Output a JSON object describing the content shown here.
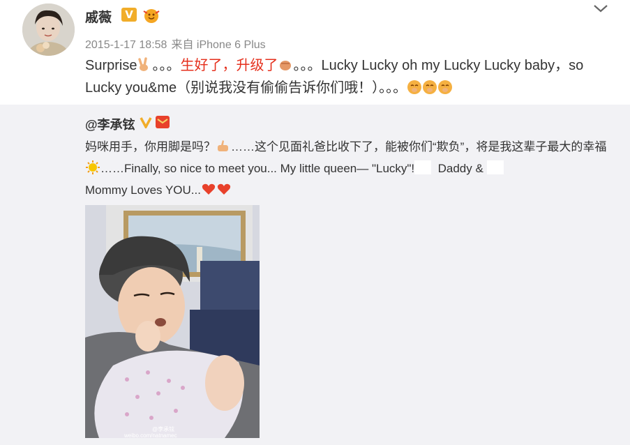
{
  "post": {
    "username": "戚薇",
    "verified_badge": "V",
    "timestamp": "2015-1-17 18:58",
    "source_prefix": "来自",
    "source": "iPhone 6 Plus",
    "text_part1": "Surprise",
    "text_part2": "。。。",
    "text_red": "生好了，升级了",
    "text_part3": "。。。Lucky Lucky oh my Lucky Lucky baby，so Lucky you&me（别说我没有偷偷告诉你们哦！）。。。"
  },
  "repost": {
    "username": "@李承铉",
    "text_part1": "妈咪用手，你用脚是吗？",
    "text_part2": "……这个见面礼爸比收下了，能被你们“欺负”，将是我这辈子最大的幸福",
    "text_part3": "……Finally, so nice to meet you...  My little queen— \"Lucky\"!",
    "text_part4": "Daddy &",
    "text_part5": "Mommy Loves YOU...",
    "photo_watermark_handle": "@李承铉",
    "photo_watermark_url": "weibo.com/natnamec"
  },
  "icons": {
    "chevron": "chevron-down-icon",
    "victory": "victory-hand-emoji",
    "fist": "fist-emoji",
    "giggle": "giggle-emoji",
    "thumbs": "thumbs-up-emoji",
    "sun": "sun-emoji",
    "heart": "heart-emoji"
  },
  "colors": {
    "accent_red": "#e52f1c",
    "badge_gold": "#f1ad2a",
    "meta_gray": "#888888",
    "repost_bg": "#f2f2f5"
  }
}
